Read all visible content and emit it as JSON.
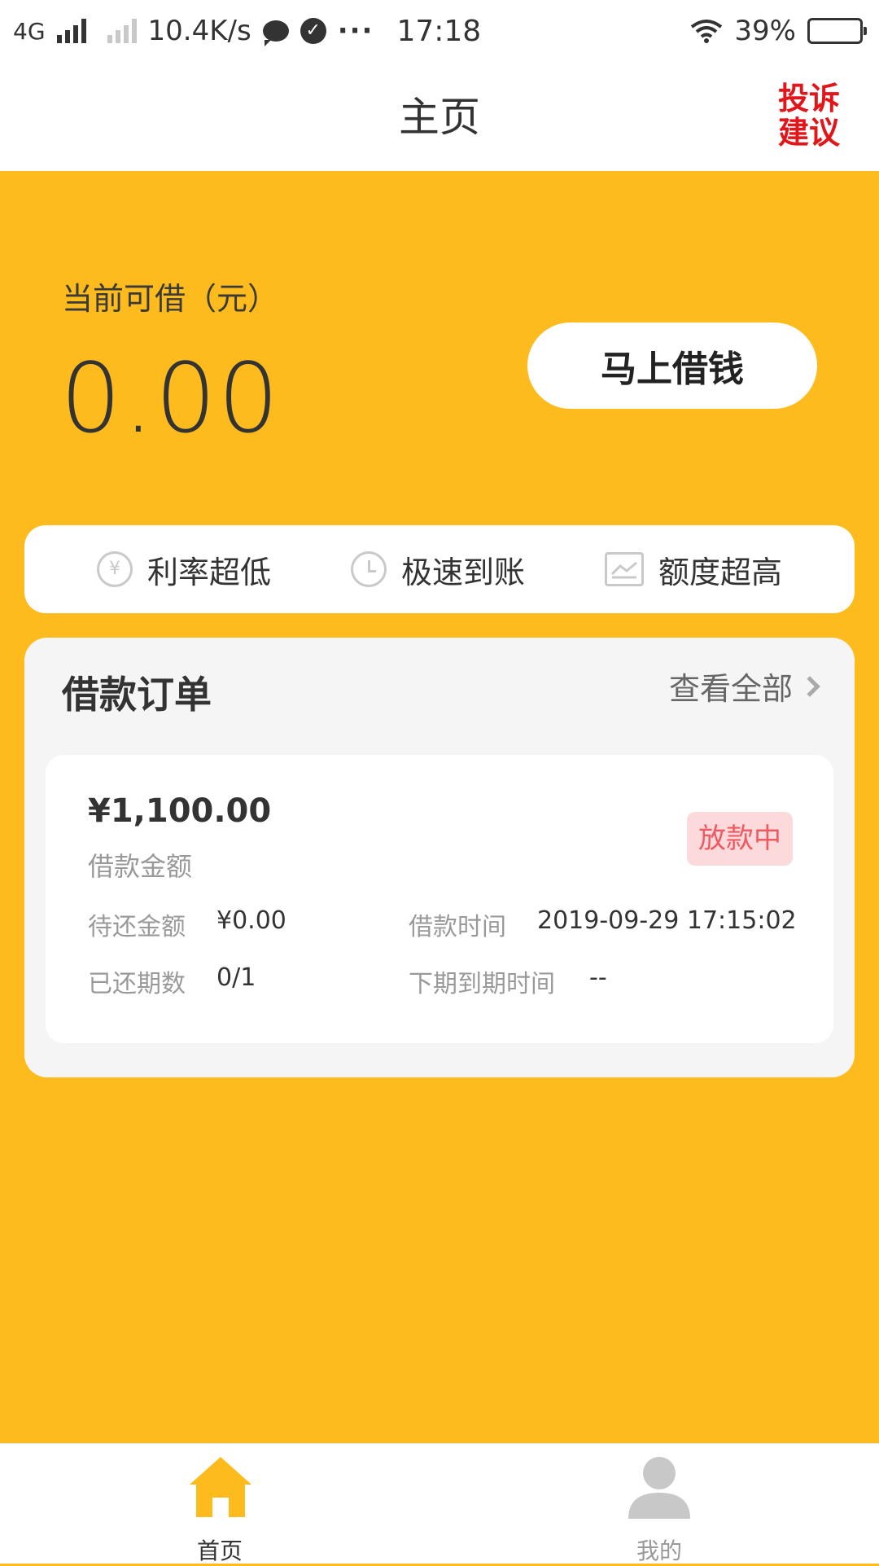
{
  "status_bar": {
    "network": "4G",
    "speed": "10.4K/s",
    "dots": "···",
    "time": "17:18",
    "battery": "39%",
    "battery_level": 0.39
  },
  "nav": {
    "title": "主页",
    "complaint_line1": "投诉",
    "complaint_line2": "建议"
  },
  "hero": {
    "label": "当前可借（元）",
    "amount": "0.00",
    "borrow_button": "马上借钱"
  },
  "features": [
    {
      "icon": "yen-icon",
      "label": "利率超低"
    },
    {
      "icon": "clock-icon",
      "label": "极速到账"
    },
    {
      "icon": "chart-icon",
      "label": "额度超高"
    }
  ],
  "orders": {
    "title": "借款订单",
    "view_all": "查看全部",
    "card": {
      "amount": "¥1,100.00",
      "amount_label": "借款金额",
      "status": "放款中",
      "pending_label": "待还金额",
      "pending_value": "¥0.00",
      "time_label": "借款时间",
      "time_value": "2019-09-29 17:15:02",
      "periods_label": "已还期数",
      "periods_value": "0/1",
      "next_due_label": "下期到期时间",
      "next_due_value": "--"
    }
  },
  "tabs": [
    {
      "label": "首页",
      "icon": "home-icon",
      "active": true
    },
    {
      "label": "我的",
      "icon": "person-icon",
      "active": false
    }
  ],
  "colors": {
    "brand_yellow": "#FDBB1E",
    "complaint_red": "#E2161A",
    "status_pink_bg": "#FCDADB",
    "status_pink_text": "#EF5A62",
    "tab_active_icon": "#FDBB1E",
    "tab_inactive_icon": "#C8C8C8"
  }
}
